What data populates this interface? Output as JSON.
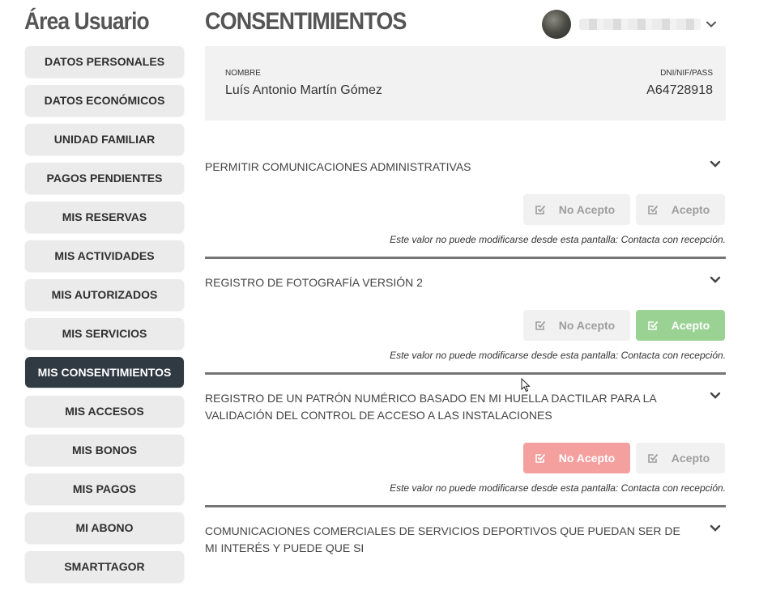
{
  "sidebar": {
    "title": "Área Usuario",
    "items": [
      {
        "label": "DATOS PERSONALES"
      },
      {
        "label": "DATOS ECONÓMICOS"
      },
      {
        "label": "UNIDAD FAMILIAR"
      },
      {
        "label": "PAGOS PENDIENTES"
      },
      {
        "label": "MIS RESERVAS"
      },
      {
        "label": "MIS ACTIVIDADES"
      },
      {
        "label": "MIS AUTORIZADOS"
      },
      {
        "label": "MIS SERVICIOS"
      },
      {
        "label": "MIS CONSENTIMIENTOS",
        "active": true
      },
      {
        "label": "MIS ACCESOS"
      },
      {
        "label": "MIS BONOS"
      },
      {
        "label": "MIS PAGOS"
      },
      {
        "label": "MI ABONO"
      },
      {
        "label": "SMARTTAGOR"
      }
    ]
  },
  "header": {
    "title": "CONSENTIMIENTOS",
    "user_menu_icon": "chevron-down-icon"
  },
  "profile": {
    "name_label": "NOMBRE",
    "name_value": "Luís Antonio Martín Gómez",
    "id_label": "DNI/NIF/PASS",
    "id_value": "A64728918"
  },
  "consents": [
    {
      "title": "PERMITIR COMUNICACIONES ADMINISTRATIVAS",
      "reject_label": "No Acepto",
      "accept_label": "Acepto",
      "selected": "none",
      "note": "Este valor no puede modificarse desde esta pantalla: Contacta con recepción."
    },
    {
      "title": "REGISTRO DE FOTOGRAFÍA VERSIÓN 2",
      "reject_label": "No Acepto",
      "accept_label": "Acepto",
      "selected": "accept",
      "note": "Este valor no puede modificarse desde esta pantalla: Contacta con recepción."
    },
    {
      "title": "REGISTRO DE UN PATRÓN NUMÉRICO BASADO EN MI HUELLA DACTILAR PARA LA VALIDACIÓN DEL CONTROL DE ACCESO A LAS INSTALACIONES",
      "reject_label": "No Acepto",
      "accept_label": "Acepto",
      "selected": "reject",
      "note": "Este valor no puede modificarse desde esta pantalla: Contacta con recepción."
    },
    {
      "title": "COMUNICACIONES COMERCIALES DE SERVICIOS DEPORTIVOS QUE PUEDAN SER DE MI INTERÉS Y PUEDE QUE SI"
    }
  ],
  "colors": {
    "active_menu": "#2f3a43",
    "accept_active": "#9ad294",
    "reject_active": "#f4a09f",
    "button_inactive": "#f1f1f1"
  },
  "icons": {
    "button_icon": "checkbox-check-icon",
    "section_toggle": "chevron-down-icon"
  }
}
